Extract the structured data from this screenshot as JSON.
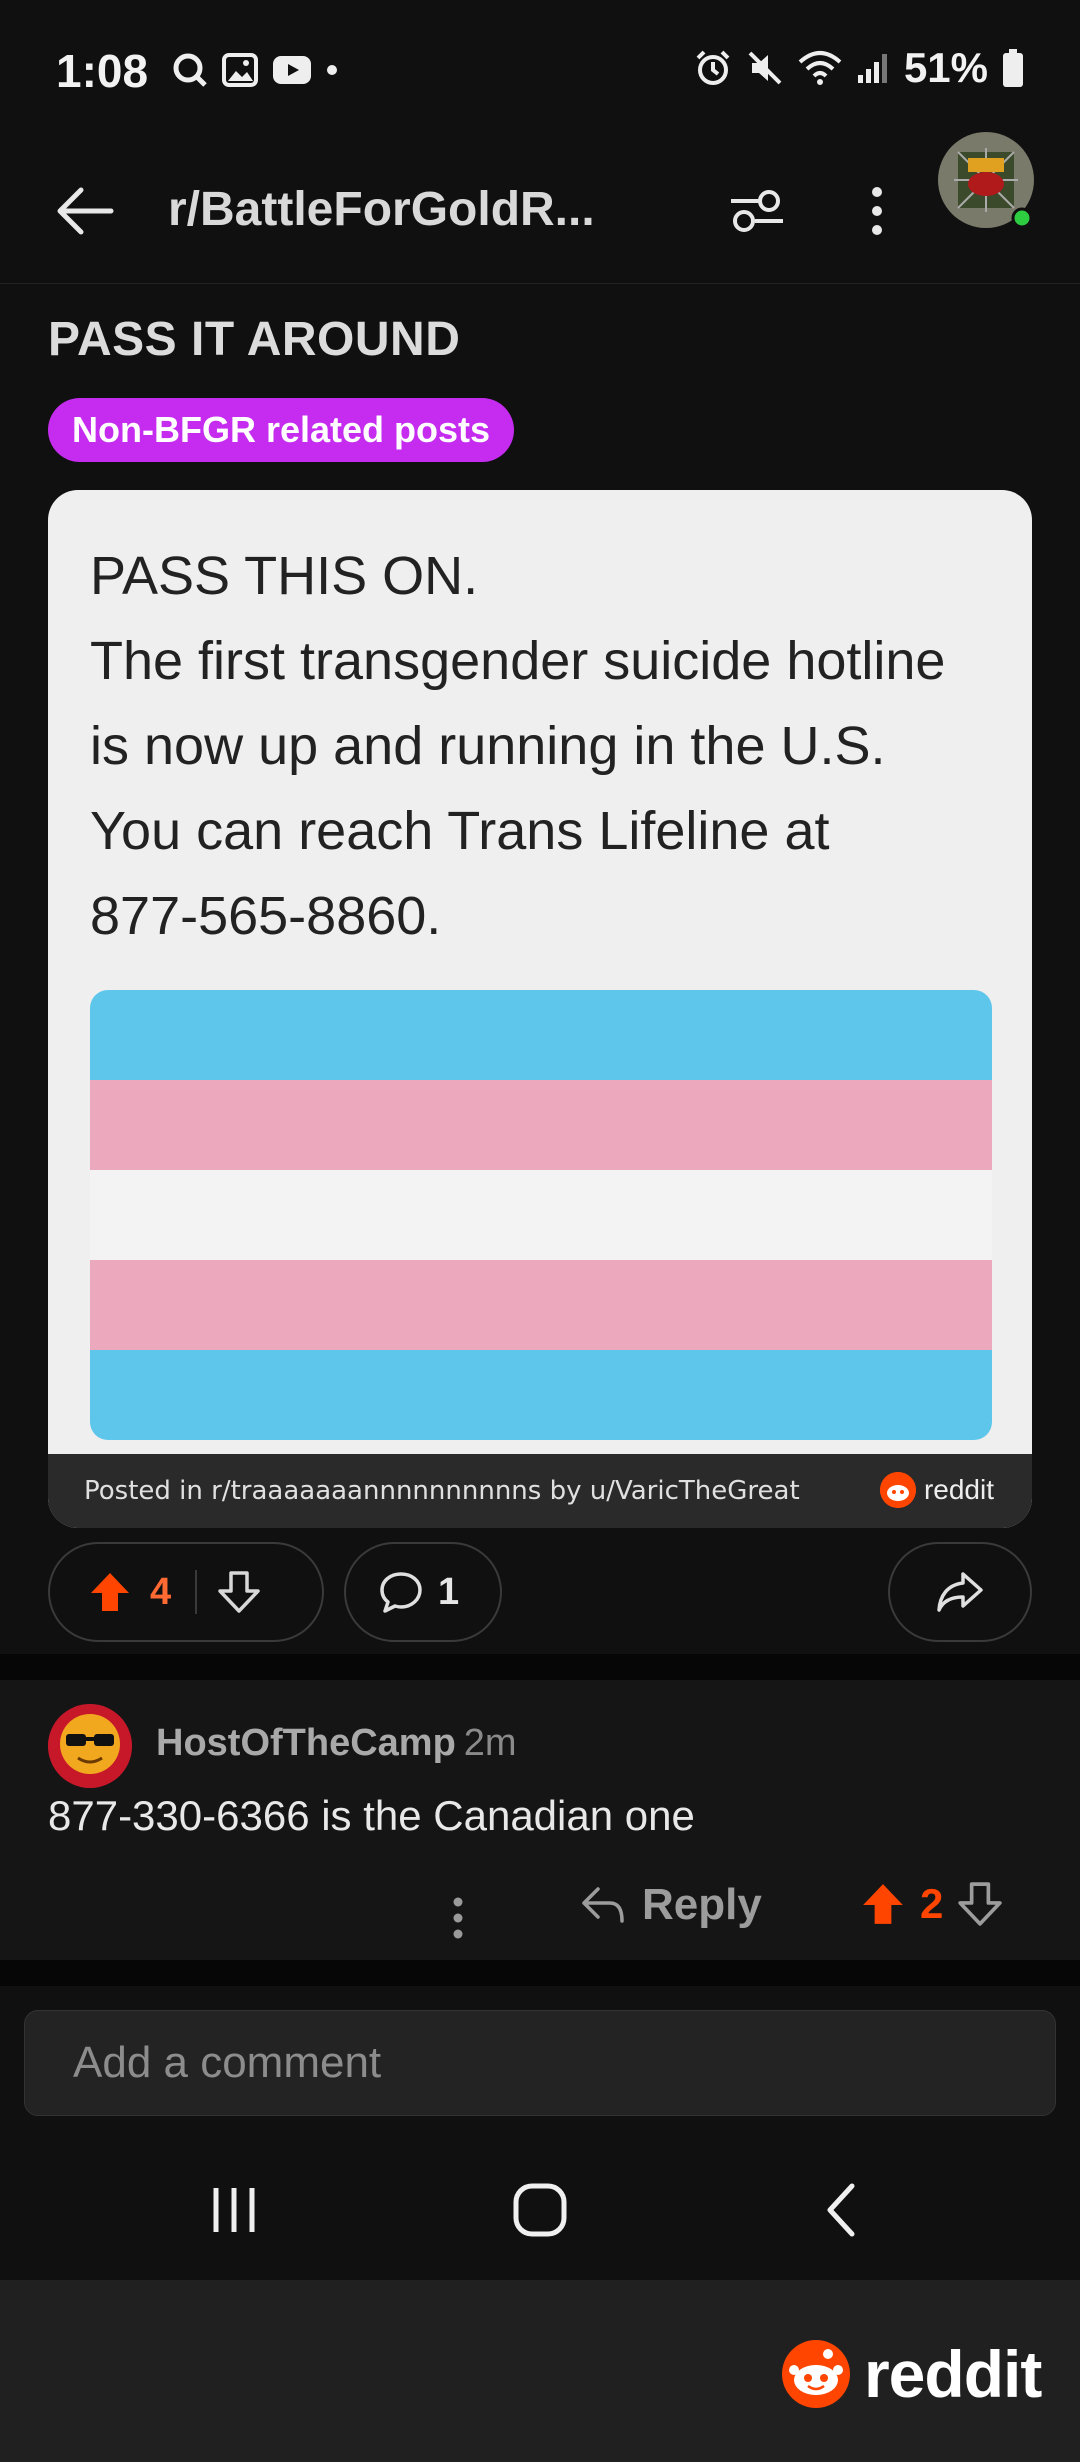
{
  "status_bar": {
    "time": "1:08",
    "battery": "51%"
  },
  "header": {
    "title": "r/BattleForGoldR..."
  },
  "post": {
    "title": "PASS IT AROUND",
    "flair": "Non-BFGR related posts",
    "image_text": [
      "PASS THIS ON.",
      "The first transgender suicide hotline",
      "is now up and running in the U.S.",
      "You can reach Trans Lifeline at",
      "877-565-8860."
    ],
    "posted_in": "Posted in r/traaaaaaannnnnnnnnns by u/VaricTheGreat",
    "reddit_mini_label": "reddit",
    "vote_count": "4",
    "comment_count": "1"
  },
  "comment": {
    "author": "HostOfTheCamp",
    "time": "2m",
    "body": "877-330-6366 is the Canadian one",
    "reply_label": "Reply",
    "vote_count": "2"
  },
  "composer": {
    "placeholder": "Add a comment"
  },
  "watermark": {
    "label": "reddit"
  },
  "colors": {
    "accent_orange": "#ff4500",
    "flair_purple": "#c52cf0",
    "flag_blue": "#5ec6ea",
    "flag_pink": "#eca8bd"
  }
}
